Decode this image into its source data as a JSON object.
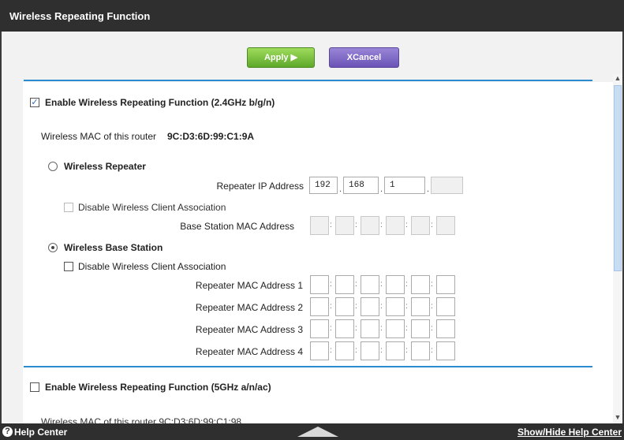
{
  "header": {
    "title": "Wireless Repeating Function"
  },
  "actions": {
    "apply_label": "Apply ▶",
    "cancel_label": "XCancel"
  },
  "section24": {
    "enable_label": "Enable Wireless Repeating Function (2.4GHz b/g/n)",
    "enable_checked": true,
    "mac_label": "Wireless MAC of this router",
    "mac_value": "9C:D3:6D:99:C1:9A",
    "repeater": {
      "label": "Wireless Repeater",
      "ip_label": "Repeater IP Address",
      "ip_parts": [
        "192",
        "168",
        "1",
        ""
      ],
      "disable_assoc_label": "Disable Wireless Client Association",
      "base_mac_label": "Base Station MAC Address"
    },
    "base_station": {
      "label": "Wireless Base Station",
      "selected": true,
      "disable_assoc_label": "Disable Wireless Client Association",
      "repeater_macs": [
        "Repeater MAC Address 1",
        "Repeater MAC Address 2",
        "Repeater MAC Address 3",
        "Repeater MAC Address 4"
      ]
    }
  },
  "section5": {
    "enable_label": "Enable Wireless Repeating Function (5GHz a/n/ac)",
    "enable_checked": false,
    "mac_partial": "Wireless MAC of this router 9C:D3:6D:99:C1:98"
  },
  "footer": {
    "help_icon": "?",
    "help_label": "Help Center",
    "toggle_label": "Show/Hide Help Center"
  },
  "colors": {
    "accent": "#2a8bd0",
    "apply": "#6cb534",
    "cancel": "#7a63c6",
    "bar": "#2f2f2f"
  }
}
